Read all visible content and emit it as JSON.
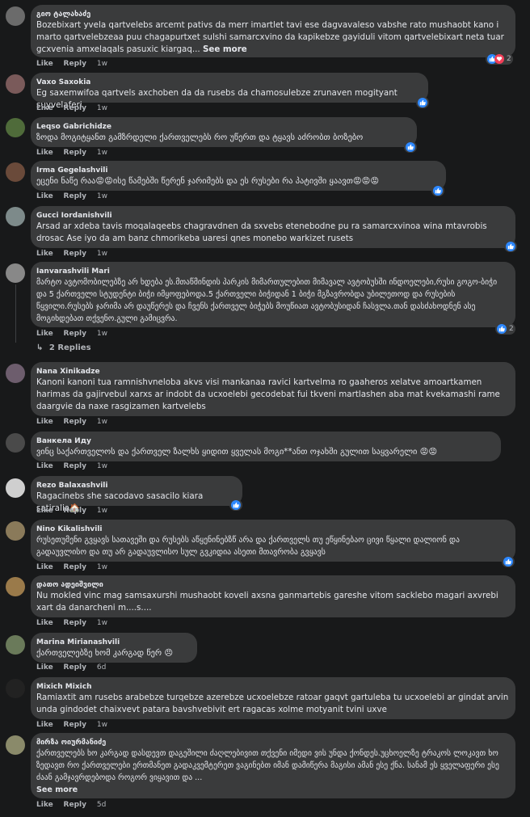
{
  "comments": [
    {
      "author": "გიო ტალახაძე",
      "text": "Bozebixart yvela qartvelebs arcemt pativs da merr imartlet tavi ese dagvavaleso vabshe rato mushaobt kano i marto qartvelebzeaa puu chagapurtxet sulshi samarcxvino da kapikebze gayiduli vitom qartvelebixart neta tuar gcxvenia amxelaqals pasuxic kiargaq...",
      "see_more": "See more",
      "like": "Like",
      "reply": "Reply",
      "time": "1w",
      "reactions": "2"
    },
    {
      "author": "Vaxo Saxokia",
      "text": "Eg saxemwifoa qartvels axchoben da da rusebs da chamosulebze zrunaven mogityant suyvelaferi",
      "like": "Like",
      "reply": "Reply",
      "time": "1w"
    },
    {
      "author": "Leqso Gabrichidze",
      "text": "ზოდა მოგიტყანთ გამზრდელი ქართველებს რო უწერთ და ტყავს აძრობთ ბოზებო",
      "like": "Like",
      "reply": "Reply",
      "time": "1w"
    },
    {
      "author": "Irma Gegelashvili",
      "text": "ეცენი ნაწე რაა😡😡ისე წამებში წერენ ჯარიმებს და ეს რუსები რა პატივში ყაავთ😡😡😡",
      "like": "Like",
      "reply": "Reply",
      "time": "1w"
    },
    {
      "author": "Gucci Iordanishvili",
      "text": "Arsad ar xdeba tavis moqalaqeebs chagravdnen da sxvebs etenebodne pu ra samarcxvinoa wina mtavrobis drosac Ase iyo da am banz chmorikeba uaresi qnes monebo warkizet rusets",
      "like": "Like",
      "reply": "Reply",
      "time": "1w"
    },
    {
      "author": "Ianvarashvili Mari",
      "text": "მარტო ავტომობილებზე არ ხდება ეს.მთაწმინდის პარკის მიმართულებით მიმავალ ავტობუსში ინდოელები,რუსი გოგო-ბიჭი და 5 ქართველი სტუდენტი ბიჭი იმყოფებოდა.5 ქართველი ბიჭიდან 1 ბიჭი მგზავრობდა უბილეთოდ და რუსების წყვილი.რუსებს ჯარიმა არ დაუწერეს და ჩვენს ქართველ ბიჭებს მოუწიათ ავტობუსიდან ჩასვლა.თან დასძახოდნენ ასე მოგიხდებათ თქვენო.გული გამიცვრა.",
      "like": "Like",
      "reply": "Reply",
      "time": "1w",
      "reactions": "2",
      "replies": "2 Replies"
    },
    {
      "author": "Nana Xinikadze",
      "text": "Kanoni kanoni tua ramnishvneloba akvs visi mankanaa ravici kartvelma ro gaaheros xelatve amoartkamen harimas da gajirvebul xarxs ar indobt da ucxoelebi gecodebat fui tkveni martlashen aba mat kvekamashi rame daargvie da naxe rasgizamen kartvelebs",
      "like": "Like",
      "reply": "Reply",
      "time": "1w"
    },
    {
      "author": "Ванкела Иду",
      "text": "ვინც საქართველოს და ქართველ ზალხს ყიდით ყველას მოგი**ანთ ოჯახში გულით საყვარელი 😡😡",
      "like": "Like",
      "reply": "Reply",
      "time": "1w"
    },
    {
      "author": "Rezo Balaxashvili",
      "text": "Ragacinebs she sacodavo sasacilo kiara satiralia🏠",
      "like": "Like",
      "reply": "Reply",
      "time": "1w"
    },
    {
      "author": "Nino Kikalishvili",
      "text": "რუსეთუმენი გვყავს სათავეში და რუსებს აწყენინებზწ არა და ქართველს თუ ეწყინებაო ცივი წყალი დალიონ და გადაუვლისო და თუ არ გადაუვლისო სულ გვკიდია ასეთი მთავრობა გვყავს",
      "like": "Like",
      "reply": "Reply",
      "time": "1w"
    },
    {
      "author": "დათო ადეიშვილი",
      "text": "Nu mokled vinc mag samsaxurshi mushaobt koveli axsna ganmartebis gareshe vitom sacklebo magari axvrebi xart da danarcheni m....s....",
      "like": "Like",
      "reply": "Reply",
      "time": "1w"
    },
    {
      "author": "Marina Mirianashvili",
      "text": "ქართველებზე ხომ კარგად წერ 😠",
      "like": "Like",
      "reply": "Reply",
      "time": "6d"
    },
    {
      "author": "Mixich Mixich",
      "text": "Ramiaxtit am rusebs arabebze turqebze azerebze ucxoelebze ratoar gaqvt gartuleba tu ucxoelebi ar gindat arvin unda gindodet chaixvevt patara bavshvebivit ert ragacas xolme motyanit tvini uxve",
      "like": "Like",
      "reply": "Reply",
      "time": "1w"
    },
    {
      "author": "მირზა ოიურმანიძე",
      "text": "ქართველებს ხო კარგად დასდევთ დაგეშილი ძაღლებივით თქვენი იმედი ვის უნდა ქონდეს.უცხოელზე ტრაკოს ლოკავთ ხო ზედავთ რო ქართველები ერთმანეთ გადაკვემტერეთ ვაგინებთ იმან დამიწერა მაგისი ამან ესე ქნა. სანამ ეს ყველაფერი ესე ძაან გამჯავრდებოდა როგორ ვიყავით და ...",
      "see_more": "See more",
      "like": "Like",
      "reply": "Reply",
      "time": "5d"
    }
  ]
}
